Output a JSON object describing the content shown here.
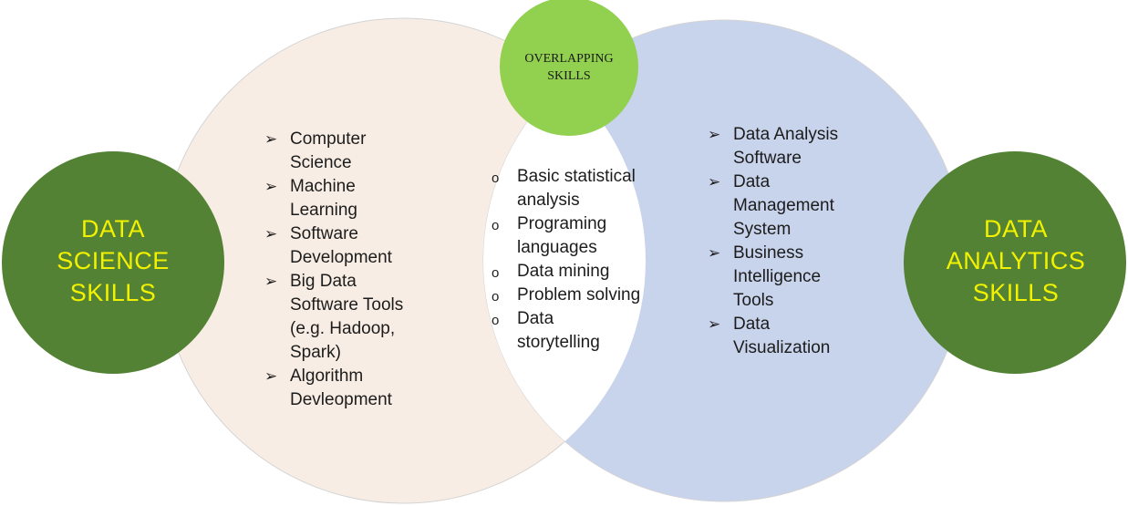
{
  "diagram": {
    "colors": {
      "left_circle": "#f8ede4",
      "right_circle": "#c8d3ec",
      "outline": "#d4d4d4",
      "overlap": "#ffffff",
      "skill_circle": "#548235",
      "overlap_circle": "#92d050",
      "skill_text": "#f2f200"
    },
    "overlapping": {
      "title": [
        "OVERLAPPING",
        "SKILLS"
      ],
      "marker": "o",
      "items": [
        [
          "Basic statistical",
          "analysis"
        ],
        [
          "Programing",
          "languages"
        ],
        [
          "Data mining"
        ],
        [
          "Problem solving"
        ],
        [
          "Data",
          "storytelling"
        ]
      ]
    },
    "data_science": {
      "title": [
        "DATA",
        "SCIENCE",
        "SKILLS"
      ],
      "marker": "➢",
      "items": [
        [
          "Computer",
          "Science"
        ],
        [
          "Machine",
          "Learning"
        ],
        [
          "Software",
          "Development"
        ],
        [
          "Big Data",
          "Software Tools",
          "(e.g. Hadoop,",
          "Spark)"
        ],
        [
          "Algorithm",
          "Devleopment"
        ]
      ]
    },
    "data_analytics": {
      "title": [
        "DATA",
        "ANALYTICS",
        "SKILLS"
      ],
      "marker": "➢",
      "items": [
        [
          "Data Analysis",
          "Software"
        ],
        [
          "Data",
          "Management",
          "System"
        ],
        [
          "Business",
          "Intelligence",
          "Tools"
        ],
        [
          "Data",
          "Visualization"
        ]
      ]
    }
  }
}
